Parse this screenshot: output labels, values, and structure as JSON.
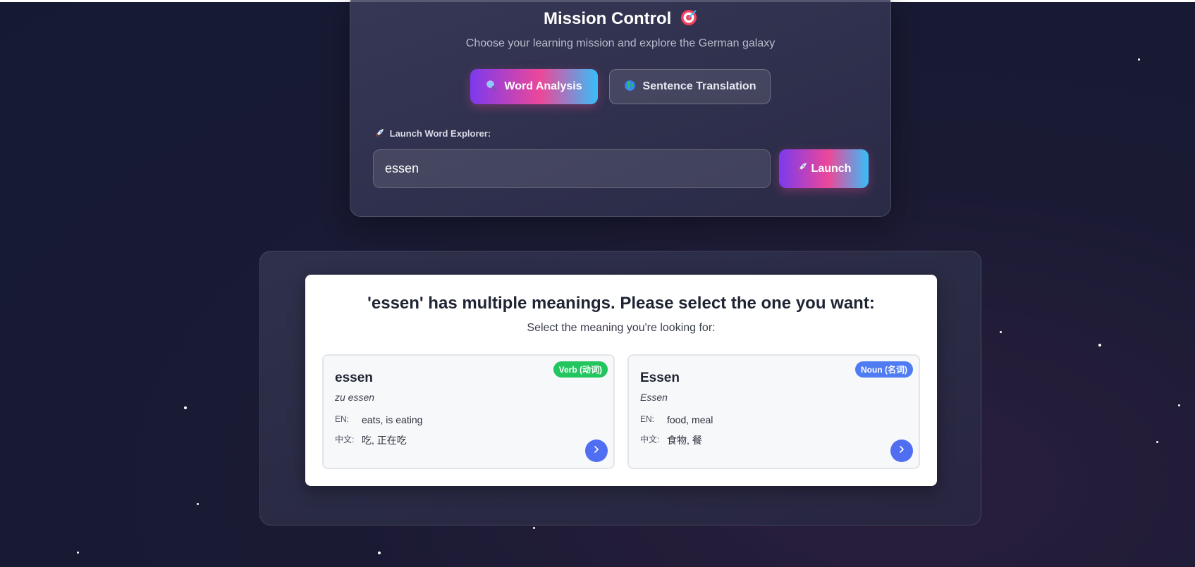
{
  "mission": {
    "title": "Mission Control",
    "title_icon": "target-icon",
    "subtitle": "Choose your learning mission and explore the German galaxy",
    "modes": [
      {
        "label": "Word Analysis",
        "icon": "magnifier-icon",
        "active": true
      },
      {
        "label": "Sentence Translation",
        "icon": "globe-icon",
        "active": false
      }
    ],
    "launch_label": "Launch Word Explorer:",
    "launch_label_icon": "rocket-icon",
    "input_value": "essen",
    "launch_button": "Launch",
    "launch_button_icon": "rocket-icon"
  },
  "results": {
    "title": "'essen' has multiple meanings. Please select the one you want:",
    "subtitle": "Select the meaning you're looking for:",
    "cards": [
      {
        "word": "essen",
        "form": "zu essen",
        "badge": "Verb (动词)",
        "en_label": "EN:",
        "en": "eats, is eating",
        "zh_label": "中文:",
        "zh": "吃, 正在吃"
      },
      {
        "word": "Essen",
        "form": "Essen",
        "badge": "Noun (名词)",
        "en_label": "EN:",
        "en": "food, meal",
        "zh_label": "中文:",
        "zh": "食物, 餐"
      }
    ]
  },
  "colors": {
    "accent_gradient": [
      "#7c3aed",
      "#ec4899",
      "#38bdf8"
    ],
    "verb_badge": "#22c55e",
    "noun_badge": "#4f7cf2",
    "select_button": "#4f6ef2"
  }
}
